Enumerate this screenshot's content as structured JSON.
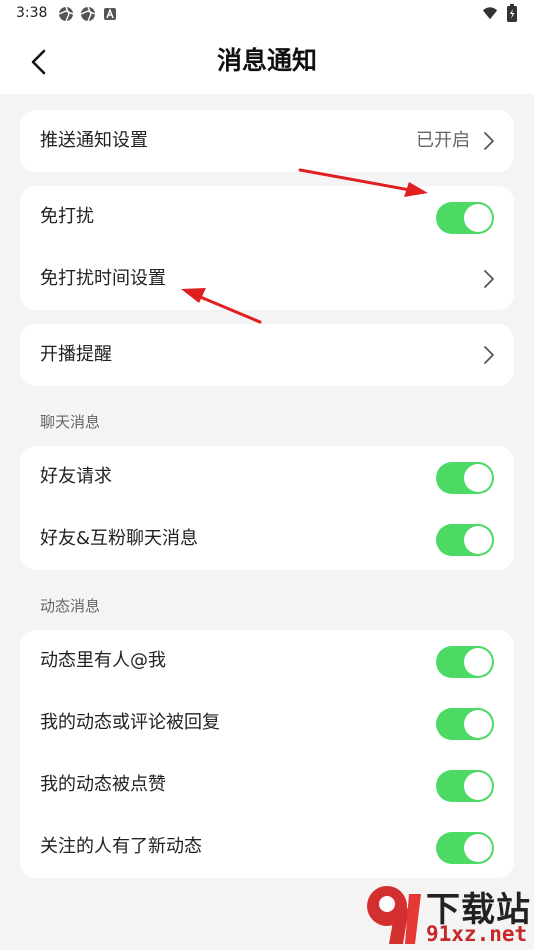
{
  "status_bar": {
    "time": "3:38",
    "left_icons": [
      "aperture-icon",
      "aperture-icon",
      "a-badge-icon"
    ],
    "right_icons": [
      "wifi-icon",
      "battery-icon"
    ]
  },
  "header": {
    "title": "消息通知",
    "back_icon": "back-arrow-icon"
  },
  "cards": {
    "push": {
      "label": "推送通知设置",
      "value": "已开启"
    },
    "dnd": {
      "items": [
        {
          "label": "免打扰",
          "control": "toggle",
          "on": true
        },
        {
          "label": "免打扰时间设置",
          "control": "chevron"
        }
      ]
    },
    "live": {
      "label": "开播提醒"
    }
  },
  "sections": {
    "chat": {
      "title": "聊天消息",
      "items": [
        {
          "label": "好友请求",
          "on": true
        },
        {
          "label": "好友&互粉聊天消息",
          "on": true
        }
      ]
    },
    "feed": {
      "title": "动态消息",
      "items": [
        {
          "label": "动态里有人@我",
          "on": true
        },
        {
          "label": "我的动态或评论被回复",
          "on": true
        },
        {
          "label": "我的动态被点赞",
          "on": true
        },
        {
          "label": "关注的人有了新动态",
          "on": true
        }
      ]
    }
  },
  "watermark": {
    "brand": "下载站",
    "domain": "91xz.net"
  },
  "colors": {
    "toggle_on": "#4cd964",
    "background": "#f4f4f4",
    "card": "#ffffff",
    "annotation_arrow": "#e02020",
    "watermark_red": "#c62828"
  }
}
